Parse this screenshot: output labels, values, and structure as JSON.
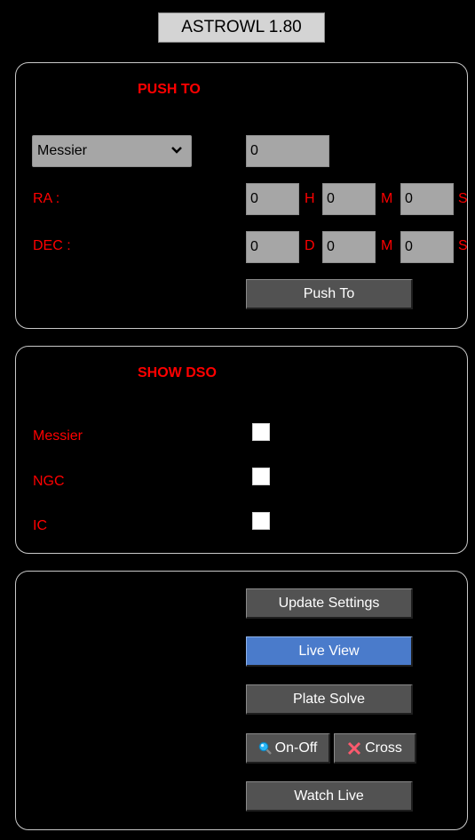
{
  "app": {
    "title": "ASTROWL 1.80"
  },
  "push_to": {
    "heading": "PUSH TO",
    "catalog_select": {
      "selected": "Messier"
    },
    "object_number": "0",
    "ra": {
      "label": "RA :",
      "h": "0",
      "m": "0",
      "s": "0",
      "h_unit": "H",
      "m_unit": "M",
      "s_unit": "S"
    },
    "dec": {
      "label": "DEC :",
      "d": "0",
      "m": "0",
      "s": "0",
      "d_unit": "D",
      "m_unit": "M",
      "s_unit": "S"
    },
    "button_label": "Push To"
  },
  "show_dso": {
    "heading": "SHOW DSO",
    "items": [
      {
        "label": "Messier",
        "checked": false
      },
      {
        "label": "NGC",
        "checked": false
      },
      {
        "label": "IC",
        "checked": false
      }
    ]
  },
  "controls": {
    "update_settings": "Update Settings",
    "live_view": "Live View",
    "plate_solve": "Plate Solve",
    "on_off": "On-Off",
    "cross": "Cross",
    "watch_live": "Watch Live"
  },
  "icons": {
    "on_off": "magnifier-icon",
    "cross": "cross-icon"
  },
  "colors": {
    "accent": "#ff0000",
    "button": "#525252",
    "primary_button": "#4a7bcb",
    "field": "#a6a6a6"
  }
}
